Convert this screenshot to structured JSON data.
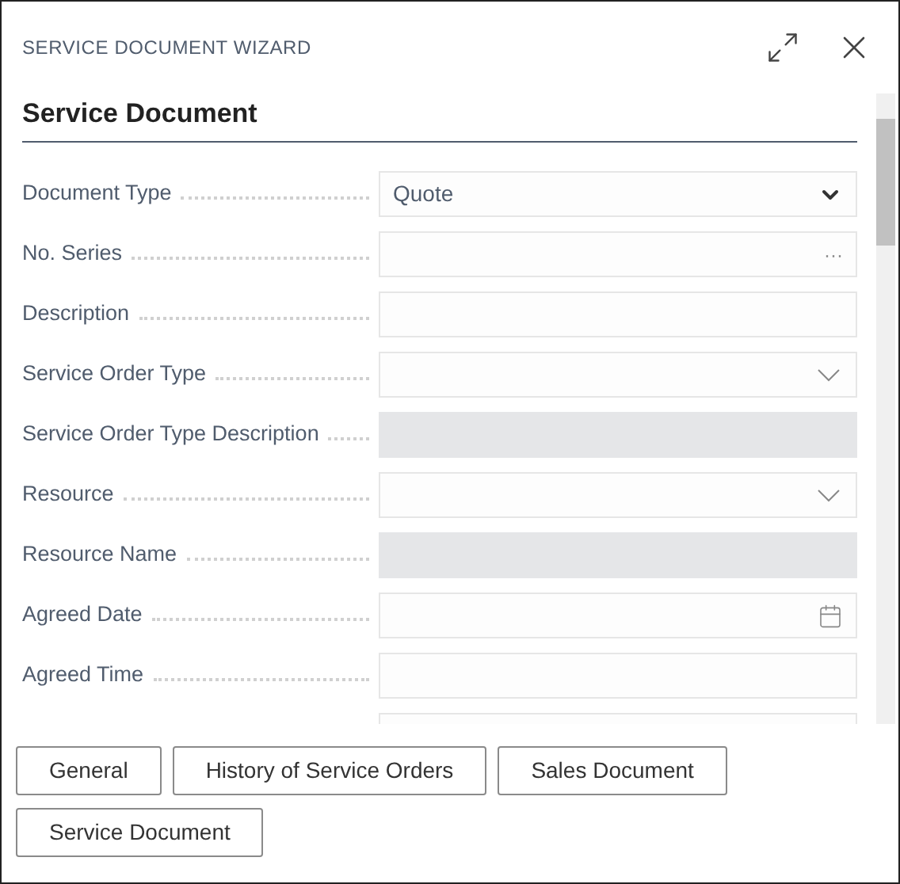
{
  "window": {
    "title": "SERVICE DOCUMENT WIZARD"
  },
  "section": {
    "title": "Service Document"
  },
  "fields": [
    {
      "label": "Document Type",
      "kind": "select",
      "value": "Quote"
    },
    {
      "label": "No. Series",
      "kind": "lookup",
      "icon_text": "···"
    },
    {
      "label": "Description",
      "kind": "text"
    },
    {
      "label": "Service Order Type",
      "kind": "dropdown"
    },
    {
      "label": "Service Order Type Description",
      "kind": "readonly"
    },
    {
      "label": "Resource",
      "kind": "dropdown"
    },
    {
      "label": "Resource Name",
      "kind": "readonly"
    },
    {
      "label": "Agreed Date",
      "kind": "date"
    },
    {
      "label": "Agreed Time",
      "kind": "text"
    },
    {
      "kind": "text"
    }
  ],
  "actions": [
    "General",
    "History of Service Orders",
    "Sales Document",
    "Service Document"
  ]
}
